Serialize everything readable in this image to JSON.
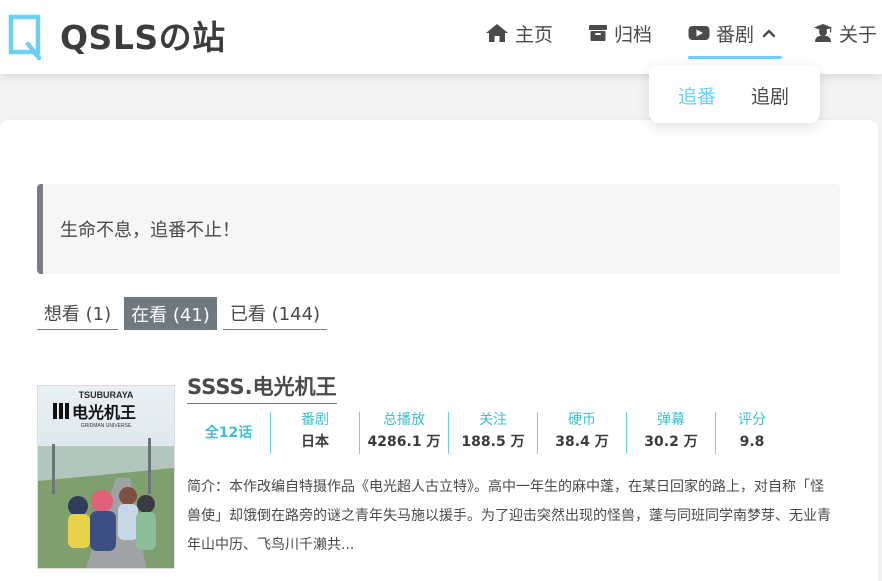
{
  "site": {
    "title": "QSLSの站"
  },
  "nav": {
    "items": [
      {
        "label": "主页",
        "icon": "home-icon"
      },
      {
        "label": "归档",
        "icon": "archive-icon"
      },
      {
        "label": "番剧",
        "icon": "youtube-play-icon"
      },
      {
        "label": "关于",
        "icon": "user-graduate-icon"
      }
    ],
    "active": "番剧",
    "dropdown": [
      {
        "label": "追番"
      },
      {
        "label": "追剧"
      }
    ],
    "dropdown_active": "追番"
  },
  "quote": {
    "text": "生命不息，追番不止！"
  },
  "tabs": [
    {
      "label": "想看 (1)"
    },
    {
      "label": "在看 (41)"
    },
    {
      "label": "已看 (144)"
    }
  ],
  "tabs_active": "在看 (41)",
  "anime": {
    "title": "SSSS.电光机王",
    "episodes": "全12话",
    "stats": [
      {
        "label": "番剧",
        "value": "日本"
      },
      {
        "label": "总播放",
        "value": "4286.1 万"
      },
      {
        "label": "关注",
        "value": "188.5 万"
      },
      {
        "label": "硬币",
        "value": "38.4 万"
      },
      {
        "label": "弹幕",
        "value": "30.2 万"
      },
      {
        "label": "评分",
        "value": "9.8"
      }
    ],
    "description": "简介：本作改编自特摄作品《电光超人古立特》。高中一年生的麻中蓬，在某日回家的路上，对自称「怪兽使」却饿倒在路旁的谜之青年失马施以援手。为了迎击突然出现的怪兽，蓬与同班同学南梦芽、无业青年山中历、飞鸟川千濑共...",
    "poster": {
      "brand": "TSUBURAYA",
      "logo": "电光机王",
      "sub": "GRIDMAN UNIVERSE"
    }
  },
  "colors": {
    "accent": "#6ccff6",
    "stat_label": "#3fbfcf",
    "tab_active_bg": "#6e7a80",
    "quote_border": "#7a7b88"
  }
}
